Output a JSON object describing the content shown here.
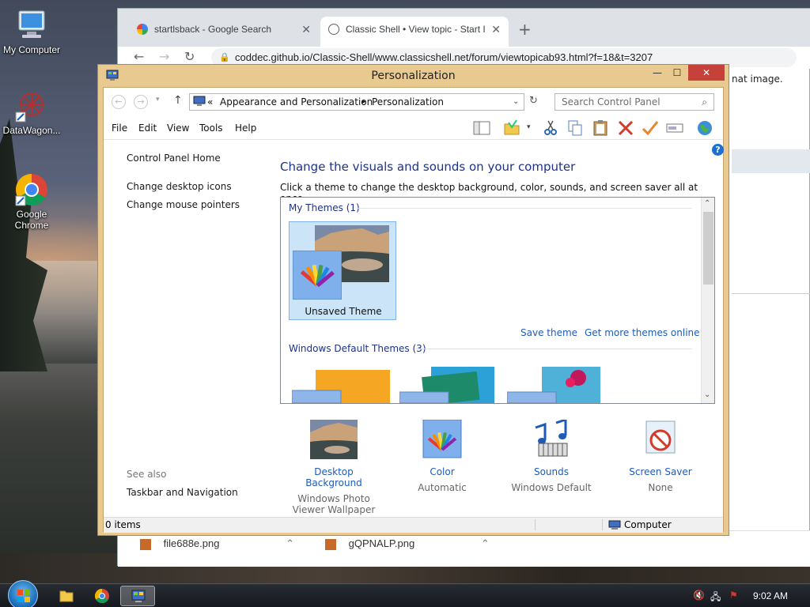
{
  "desktop": {
    "icons": [
      {
        "label": "My Computer"
      },
      {
        "label": "DataWagon..."
      },
      {
        "label": "Google Chrome"
      }
    ]
  },
  "browser": {
    "tabs": [
      {
        "label": "startlsback - Google Search"
      },
      {
        "label": "Classic Shell • View topic - Start I"
      }
    ],
    "new_tab": "+",
    "url": "coddec.github.io/Classic-Shell/www.classicshell.net/forum/viewtopicab93.html?f=18&t=3207",
    "partial_text": "nat image.",
    "downloads": [
      {
        "name": "file688e.png"
      },
      {
        "name": "gQPNALP.png"
      }
    ]
  },
  "window": {
    "title": "Personalization",
    "controls": {
      "minimize": "—",
      "maximize": "☐",
      "close": "✕"
    },
    "address": {
      "prefix": "«",
      "crumbs": [
        "Appearance and Personalization",
        "Personalization"
      ],
      "separator": "▸"
    },
    "search_placeholder": "Search Control Panel",
    "menu": [
      "File",
      "Edit",
      "View",
      "Tools",
      "Help"
    ],
    "left_pane": {
      "home": "Control Panel Home",
      "links": [
        "Change desktop icons",
        "Change mouse pointers"
      ],
      "see_also_label": "See also",
      "see_also_links": [
        "Taskbar and Navigation"
      ]
    },
    "main": {
      "title": "Change the visuals and sounds on your computer",
      "description": "Click a theme to change the desktop background, color, sounds, and screen saver all at once.",
      "my_themes_label": "My Themes (1)",
      "unsaved_theme": "Unsaved Theme",
      "save_theme": "Save theme",
      "get_more_themes": "Get more themes online",
      "default_themes_label": "Windows Default Themes (3)"
    },
    "bottom_items": [
      {
        "title": "Desktop Background",
        "sub": "Windows Photo Viewer Wallpaper"
      },
      {
        "title": "Color",
        "sub": "Automatic"
      },
      {
        "title": "Sounds",
        "sub": "Windows Default"
      },
      {
        "title": "Screen Saver",
        "sub": "None"
      }
    ],
    "status": {
      "items": "0 items",
      "location": "Computer"
    }
  },
  "taskbar": {
    "clock": "9:02 AM"
  },
  "colors": {
    "window_frame": "#e8c990",
    "close_button": "#c7413b",
    "link_blue": "#1e5bb8",
    "title_blue": "#1e3287",
    "selection": "#cce4f7"
  }
}
